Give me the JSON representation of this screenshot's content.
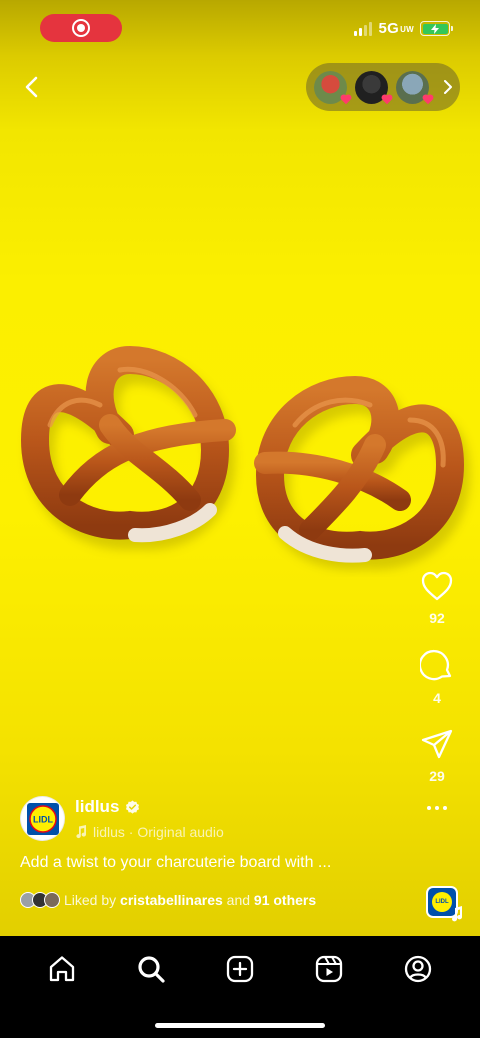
{
  "status_bar": {
    "network": "5G",
    "network_sub": "UW"
  },
  "reel": {
    "username": "lidlus",
    "verified": true,
    "audio_label": "lidlus · Original audio",
    "caption": "Add a twist to your charcuterie board with ...",
    "liked_by_prefix": "Liked by ",
    "liked_by_user": "cristabellinares",
    "liked_by_middle": " and ",
    "liked_by_others": "91 others",
    "logo_text": "LIDL"
  },
  "actions": {
    "likes": "92",
    "comments": "4",
    "shares": "29"
  },
  "icons": {
    "back": "chevron-left-icon",
    "like": "heart-icon",
    "comment": "comment-bubble-icon",
    "share": "paper-plane-icon",
    "more": "ellipsis-icon",
    "music": "music-note-icon",
    "home": "home-icon",
    "search": "search-icon",
    "create": "plus-square-icon",
    "reels": "reels-icon",
    "profile": "profile-icon"
  },
  "colors": {
    "background": "#fdf000",
    "record_pill": "#e5343e",
    "battery": "#34c759",
    "heart_badge": "#ff3b6b"
  }
}
